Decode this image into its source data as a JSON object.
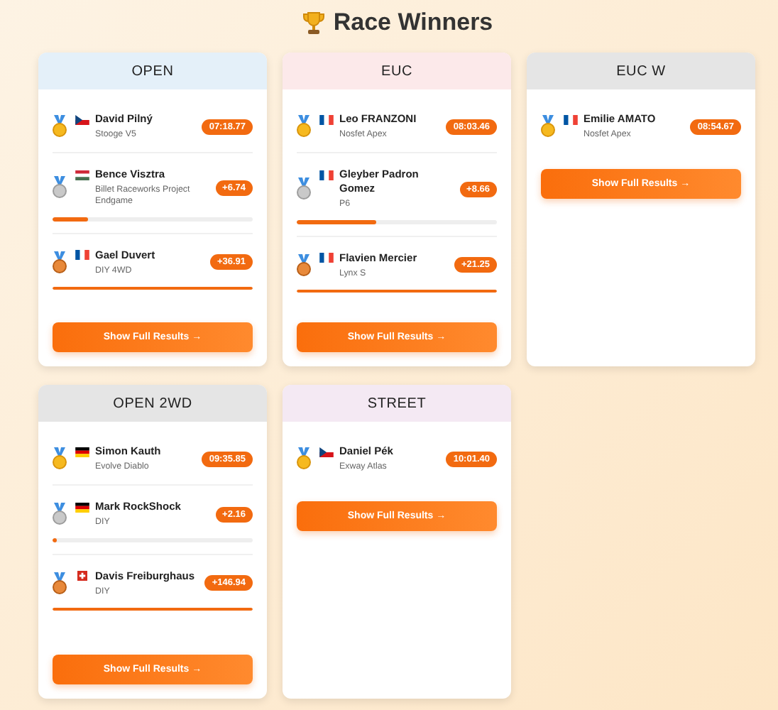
{
  "title": "Race Winners",
  "categories": [
    {
      "name": "OPEN",
      "color": "#e4f0f9",
      "entries": [
        {
          "name": "David Pilný",
          "vehicle": "Stooge V5",
          "result": "07:18.77"
        },
        {
          "name": "Bence Visztra",
          "vehicle": "Billet Raceworks Project Endgame",
          "result": "+6.74",
          "level": 0.18
        },
        {
          "name": "Gael Duvert",
          "vehicle": "DIY 4WD",
          "result": "+36.91",
          "level": 1
        }
      ],
      "button": "Show Full Results →"
    },
    {
      "name": "EUC",
      "color": "#fce9ea",
      "entries": [
        {
          "name": "Leo FRANZONI",
          "vehicle": "Nosfet Apex",
          "result": "08:03.46"
        },
        {
          "name": "Gleyber Padron Gomez",
          "vehicle": "P6",
          "result": "+8.66",
          "level": 0.4
        },
        {
          "name": "Flavien Mercier",
          "vehicle": "Lynx S",
          "result": "+21.25",
          "level": 1
        }
      ],
      "button": "Show Full Results →"
    },
    {
      "name": "EUC W",
      "color": "#e5e5e5",
      "entries": [
        {
          "name": "Emilie AMATO",
          "vehicle": "Nosfet Apex",
          "result": "08:54.67"
        }
      ],
      "button": "Show Full Results →"
    },
    {
      "name": "OPEN 2WD",
      "color": "#e5e5e5",
      "entries": [
        {
          "name": "Simon Kauth",
          "vehicle": "Evolve Diablo",
          "result": "09:35.85"
        },
        {
          "name": "Mark RockShock",
          "vehicle": "DIY",
          "result": "+2.16",
          "level": 0.02
        },
        {
          "name": "Davis Freiburghaus",
          "vehicle": "DIY",
          "result": "+146.94",
          "level": 1
        }
      ],
      "button": "Show Full Results →"
    },
    {
      "name": "STREET",
      "color": "#f4e9f3",
      "entries": [
        {
          "name": "Daniel Pék",
          "vehicle": "Exway Atlas",
          "result": "10:01.40"
        }
      ],
      "button": "Show Full Results →"
    }
  ]
}
